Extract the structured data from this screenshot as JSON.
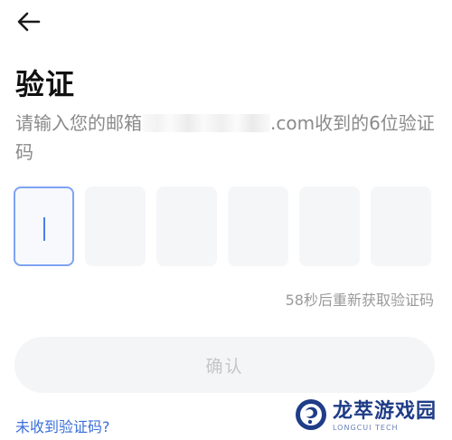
{
  "nav": {
    "back_icon": "arrow-left-icon"
  },
  "page": {
    "title": "验证",
    "subtitle_prefix": "请输入您的邮箱",
    "subtitle_suffix": ".com收到的6位验证码"
  },
  "code_input": {
    "digits": [
      "",
      "",
      "",
      "",
      "",
      ""
    ],
    "active_index": 0
  },
  "resend": {
    "countdown_text": "58秒后重新获取验证码"
  },
  "confirm_button": {
    "label": "确认"
  },
  "help": {
    "no_code_link": "未收到验证码?"
  },
  "watermark": {
    "main_text": "龙萃游戏园",
    "sub_text": "LONGCUI TECH"
  },
  "colors": {
    "accent": "#4a7fe8",
    "link": "#3a6fd8",
    "box_bg": "#f5f6f8",
    "disabled_text": "#c6c6c6"
  }
}
